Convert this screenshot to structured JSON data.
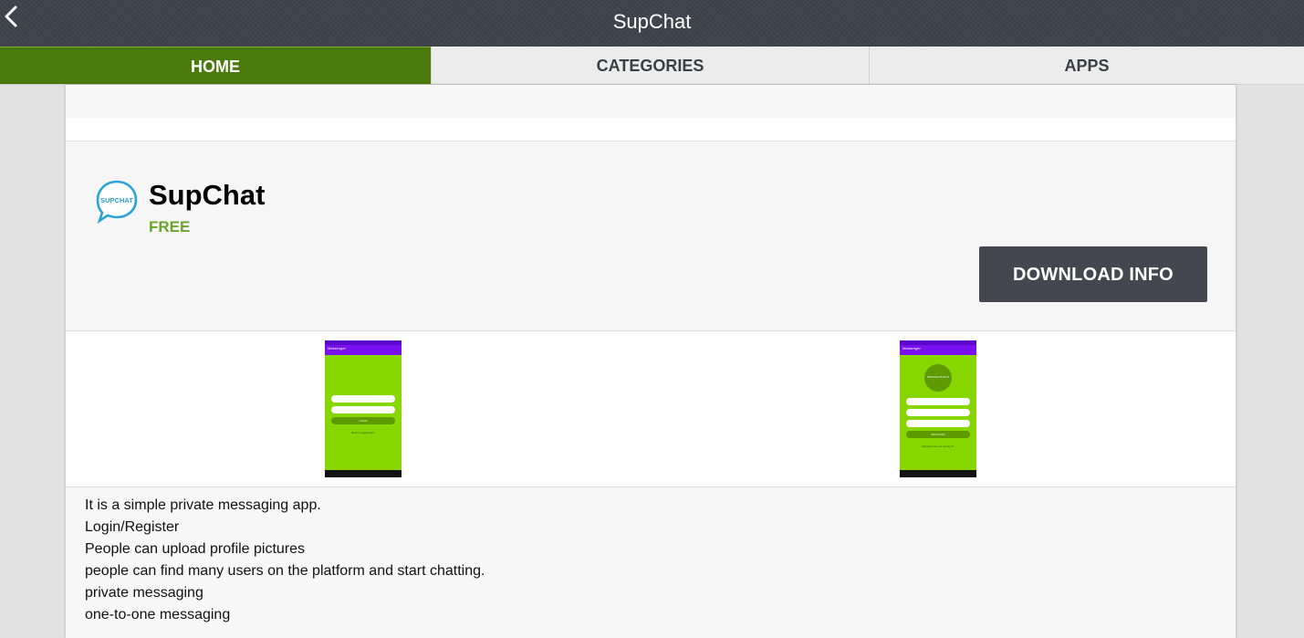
{
  "topbar": {
    "title": "SupChat",
    "back_icon": "chevron-left-icon"
  },
  "tabs": [
    {
      "label": "HOME",
      "active": true
    },
    {
      "label": "CATEGORIES",
      "active": false
    },
    {
      "label": "APPS",
      "active": false
    }
  ],
  "app": {
    "name": "SupChat",
    "price": "FREE",
    "logo_text": "SUPCHAT",
    "download_label": "DOWNLOAD INFO"
  },
  "screenshots": [
    {
      "appbar_title": "Messenger",
      "fields": [
        "Email",
        "Password"
      ],
      "button": "LOGIN",
      "link": "Back to registration"
    },
    {
      "appbar_title": "Messenger",
      "circle_label": "PROFILE PHOTO",
      "fields": [
        "Username",
        "Email",
        "Password"
      ],
      "button": "REGISTER",
      "link": "Already have an account?"
    }
  ],
  "description": [
    "It is a simple private messaging app.",
    "Login/Register",
    "People can upload profile pictures",
    "people can find many users on the platform and start chatting.",
    "private messaging",
    "one-to-one messaging"
  ],
  "colors": {
    "topbar": "#3f444c",
    "tab_active": "#4a7a0b",
    "price": "#6aa22a",
    "button": "#44474f",
    "logo": "#2aa3d6"
  }
}
